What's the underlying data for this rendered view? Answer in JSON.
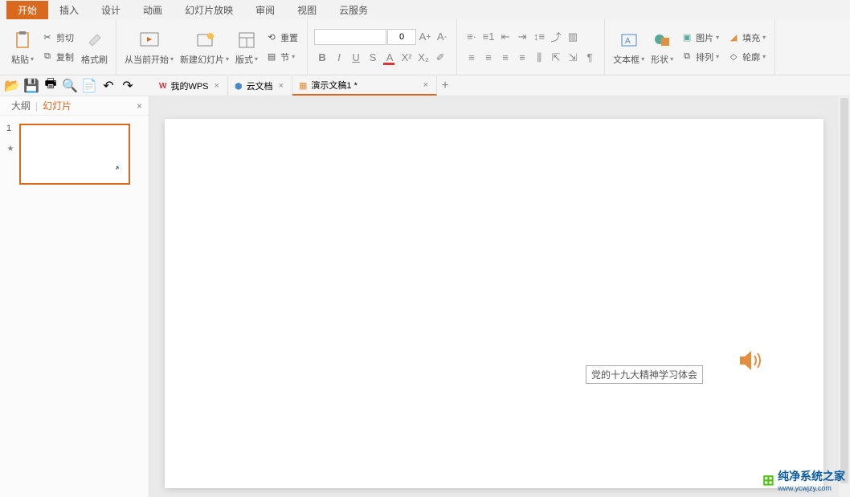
{
  "menu": [
    "开始",
    "插入",
    "设计",
    "动画",
    "幻灯片放映",
    "审阅",
    "视图",
    "云服务"
  ],
  "ribbon": {
    "paste": "粘贴",
    "cut": "剪切",
    "copy": "复制",
    "formatpainter": "格式刷",
    "startfrom": "从当前开始",
    "newslide": "新建幻灯片",
    "layout": "版式",
    "reset": "重置",
    "section": "节",
    "fontsize": "0",
    "textbox": "文本框",
    "shape": "形状",
    "picture": "图片",
    "arrange": "排列",
    "fill": "填充",
    "outline": "轮廓"
  },
  "doctabs": {
    "t1": "我的WPS",
    "t2": "云文档",
    "t3": "演示文稿1 *"
  },
  "leftpanel": {
    "outline": "大纲",
    "slides": "幻灯片",
    "num": "1"
  },
  "slide": {
    "textbox": "党的十九大精神学习体会"
  },
  "watermark": {
    "title": "纯净系统之家",
    "url": "www.ycwjzy.com"
  }
}
